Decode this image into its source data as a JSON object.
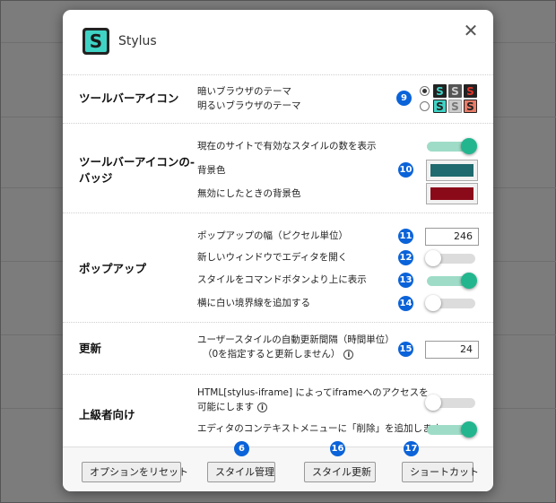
{
  "app": {
    "title": "Stylus",
    "logo_letter": "S"
  },
  "sections": {
    "toolbar_icon": {
      "title": "ツールバーアイコン",
      "badge": "9",
      "row1": "暗いブラウザのテーマ",
      "row2": "明るいブラウザのテーマ",
      "icon_letter": "S"
    },
    "toolbar_badge": {
      "title_line1": "ツールバーアイコンの-",
      "title_line2": "バッジ",
      "badge": "10",
      "row1": "現在のサイトで有効なスタイルの数を表示",
      "row2": "背景色",
      "row3": "無効にしたときの背景色",
      "bg_color": "#1f6a6e",
      "disabled_bg_color": "#8b0a1a"
    },
    "popup": {
      "title": "ポップアップ",
      "row1": "ポップアップの幅（ピクセル単位）",
      "row2": "新しいウィンドウでエディタを開く",
      "row3": "スタイルをコマンドボタンより上に表示",
      "row4": "横に白い境界線を追加する",
      "badge1": "11",
      "badge2": "12",
      "badge3": "13",
      "badge4": "14",
      "width_value": "246"
    },
    "update": {
      "title": "更新",
      "row1": "ユーザースタイルの自動更新間隔（時間単位）",
      "row1b": "（0を指定すると更新しません）",
      "badge": "15",
      "interval_value": "24"
    },
    "advanced": {
      "title": "上級者向け",
      "row1": "HTML[stylus-iframe] によってiframeへのアクセスを",
      "row1b": "可能にします",
      "row2": "エディタのコンテキストメニューに「削除」を追加します"
    }
  },
  "footer": {
    "reset": "オプションをリセット",
    "manage": "スタイル管理",
    "update": "スタイル更新",
    "shortcuts": "ショートカット",
    "badge_manage": "6",
    "badge_update": "16",
    "badge_shortcuts": "17"
  },
  "colors": {
    "accent": "#23b68e",
    "badge": "#0b63d9"
  },
  "icons": [
    "close-icon",
    "info-icon",
    "stylus-logo"
  ]
}
